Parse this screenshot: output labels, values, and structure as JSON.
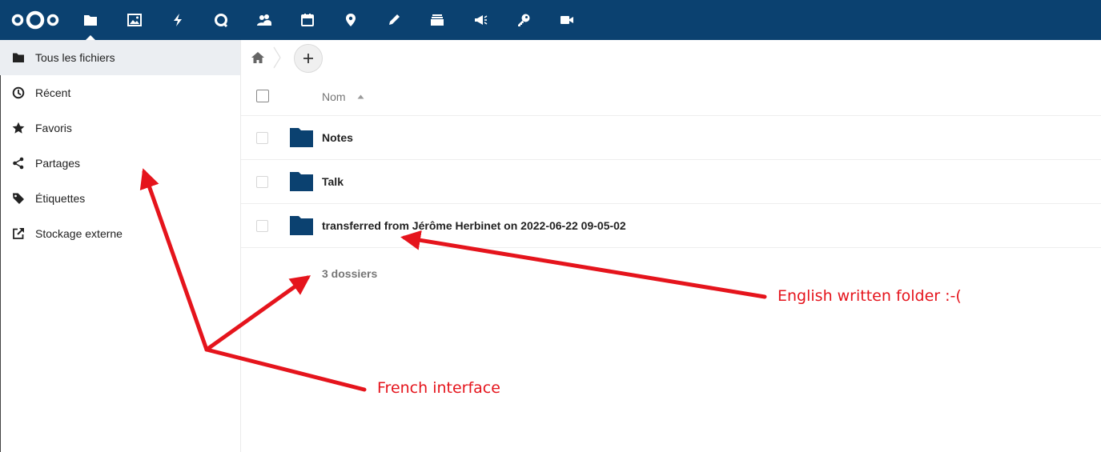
{
  "header": {
    "brand_icon": "nextcloud-logo",
    "apps": [
      {
        "icon": "files-icon",
        "active": true
      },
      {
        "icon": "photos-icon",
        "active": false
      },
      {
        "icon": "activity-icon",
        "active": false
      },
      {
        "icon": "talk-icon",
        "active": false
      },
      {
        "icon": "contacts-icon",
        "active": false
      },
      {
        "icon": "calendar-icon",
        "active": false
      },
      {
        "icon": "maps-icon",
        "active": false
      },
      {
        "icon": "notes-icon",
        "active": false
      },
      {
        "icon": "deck-icon",
        "active": false
      },
      {
        "icon": "announcements-icon",
        "active": false
      },
      {
        "icon": "passwords-icon",
        "active": false
      },
      {
        "icon": "video-icon",
        "active": false
      }
    ],
    "background": "#0b4170"
  },
  "sidebar": {
    "items": [
      {
        "label": "Tous les fichiers",
        "icon": "folder-icon",
        "active": true
      },
      {
        "label": "Récent",
        "icon": "clock-icon",
        "active": false
      },
      {
        "label": "Favoris",
        "icon": "star-icon",
        "active": false
      },
      {
        "label": "Partages",
        "icon": "share-icon",
        "active": false
      },
      {
        "label": "Étiquettes",
        "icon": "tag-icon",
        "active": false
      },
      {
        "label": "Stockage externe",
        "icon": "external-link-icon",
        "active": false
      }
    ]
  },
  "files": {
    "column_name": "Nom",
    "rows": [
      {
        "name": "Notes",
        "icon": "folder-icon"
      },
      {
        "name": "Talk",
        "icon": "folder-icon"
      },
      {
        "name": "transferred from Jérôme Herbinet on 2022-06-22 09-05-02",
        "icon": "folder-icon"
      }
    ],
    "summary": "3 dossiers",
    "folder_color": "#0b4170"
  },
  "annotations": {
    "english_note": "English written folder :-(",
    "french_note": "French interface",
    "color": "#e5141c"
  }
}
